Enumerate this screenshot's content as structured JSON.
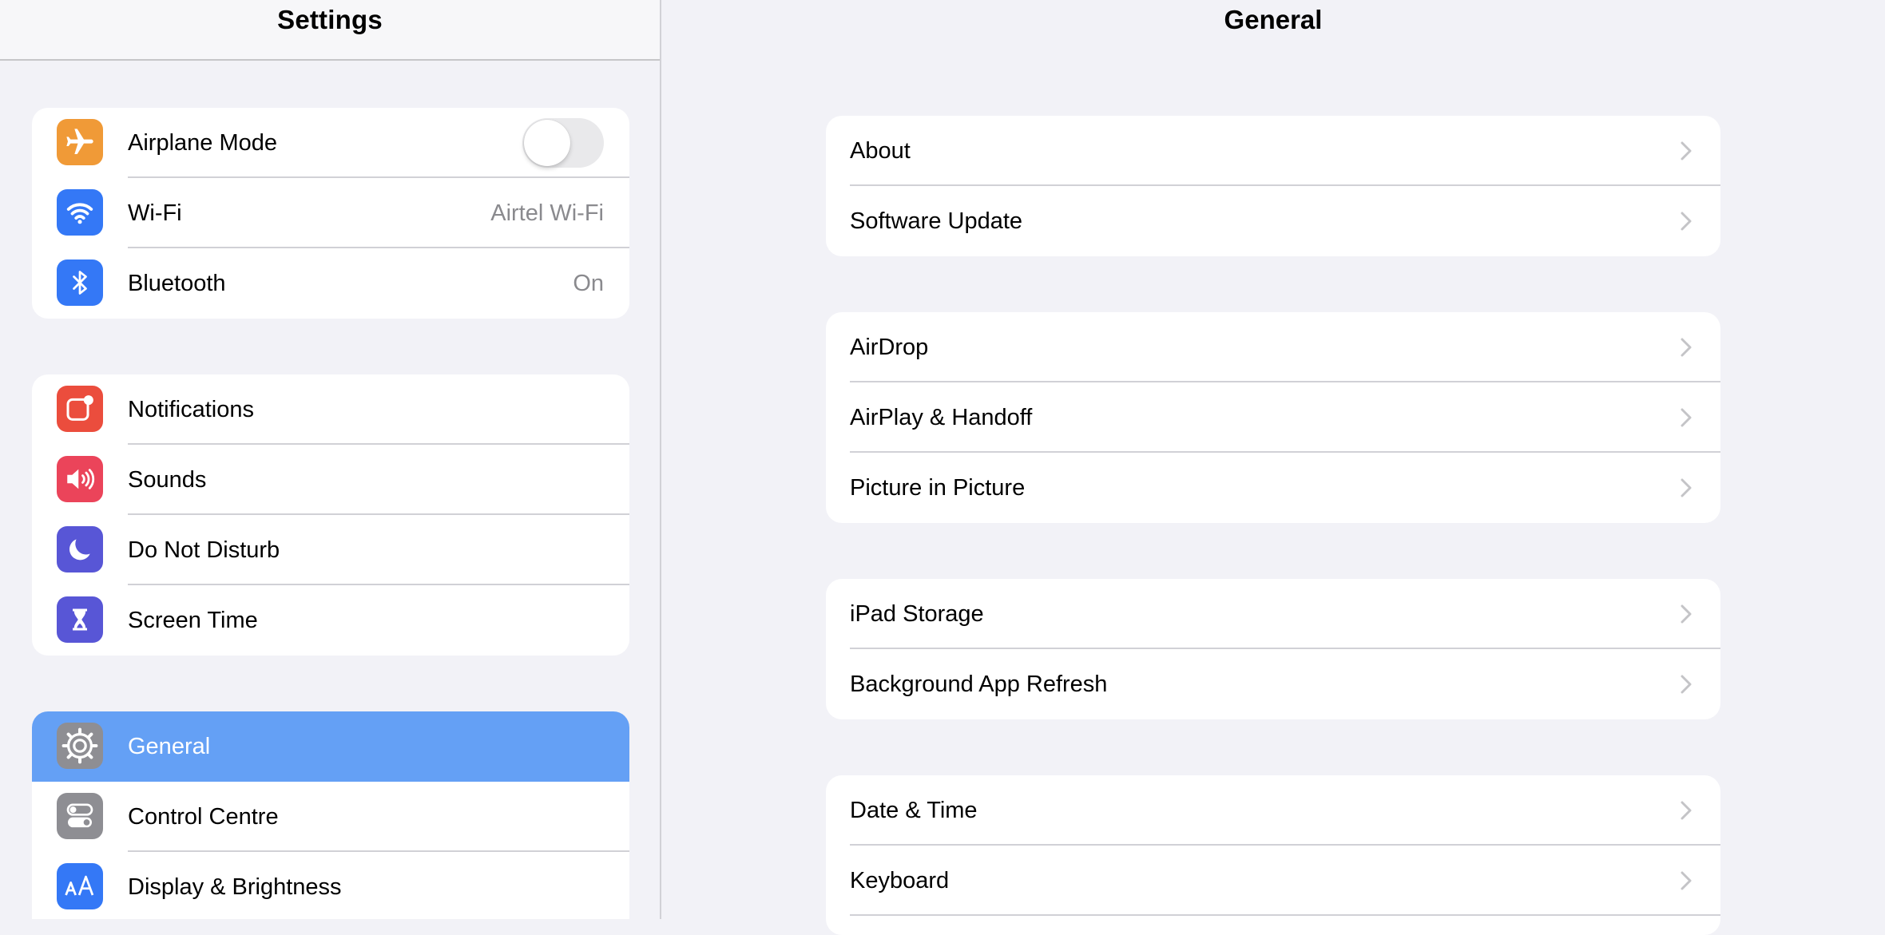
{
  "sidebar": {
    "title": "Settings",
    "groups": [
      {
        "items": [
          {
            "label": "Airplane Mode",
            "icon": "airplane-icon",
            "icon_color": "#f09a37",
            "toggle": false
          },
          {
            "label": "Wi-Fi",
            "icon": "wifi-icon",
            "icon_color": "#3478f6",
            "value": "Airtel Wi-Fi"
          },
          {
            "label": "Bluetooth",
            "icon": "bluetooth-icon",
            "icon_color": "#3478f6",
            "value": "On"
          }
        ]
      },
      {
        "items": [
          {
            "label": "Notifications",
            "icon": "notifications-icon",
            "icon_color": "#eb4d3d"
          },
          {
            "label": "Sounds",
            "icon": "speaker-icon",
            "icon_color": "#eb445a"
          },
          {
            "label": "Do Not Disturb",
            "icon": "moon-icon",
            "icon_color": "#5856d6"
          },
          {
            "label": "Screen Time",
            "icon": "hourglass-icon",
            "icon_color": "#5856d6"
          }
        ]
      },
      {
        "items": [
          {
            "label": "General",
            "icon": "gear-icon",
            "icon_color": "#8e8e93",
            "selected": true
          },
          {
            "label": "Control Centre",
            "icon": "switches-icon",
            "icon_color": "#8e8e93"
          },
          {
            "label": "Display & Brightness",
            "icon": "text-size-icon",
            "icon_color": "#3478f6"
          }
        ]
      }
    ]
  },
  "detail": {
    "title": "General",
    "groups": [
      {
        "items": [
          {
            "label": "About"
          },
          {
            "label": "Software Update"
          }
        ]
      },
      {
        "items": [
          {
            "label": "AirDrop"
          },
          {
            "label": "AirPlay & Handoff"
          },
          {
            "label": "Picture in Picture"
          }
        ]
      },
      {
        "items": [
          {
            "label": "iPad Storage"
          },
          {
            "label": "Background App Refresh"
          }
        ]
      },
      {
        "items": [
          {
            "label": "Date & Time"
          },
          {
            "label": "Keyboard"
          }
        ]
      }
    ]
  },
  "colors": {
    "selected_row": "#64a0f5",
    "background": "#f2f2f7",
    "secondary_text": "#8a8a8e",
    "chevron": "#c4c4c7"
  }
}
